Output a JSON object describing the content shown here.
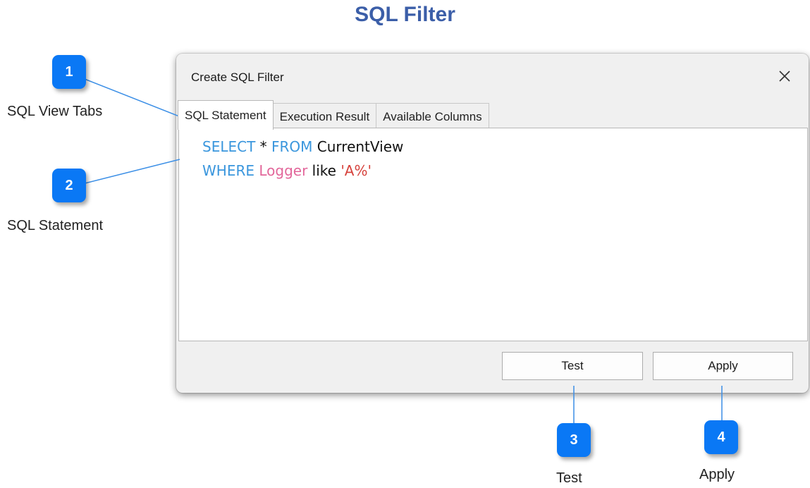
{
  "page": {
    "title": "SQL Filter"
  },
  "dialog": {
    "title": "Create SQL Filter",
    "tabs": [
      {
        "label": "SQL Statement",
        "active": true
      },
      {
        "label": "Execution Result",
        "active": false
      },
      {
        "label": "Available Columns",
        "active": false
      }
    ],
    "sql": {
      "line1": {
        "select": "SELECT",
        "star": " * ",
        "from": "FROM",
        "table": " CurrentView"
      },
      "line2": {
        "where": "WHERE",
        "column": " Logger",
        "op": " like ",
        "value": "'A%'"
      }
    },
    "buttons": {
      "test": "Test",
      "apply": "Apply"
    },
    "colors": {
      "keyword": "#3a96dd",
      "identifier": "#e2669a",
      "string": "#d6423c"
    }
  },
  "callouts": [
    {
      "number": "1",
      "label": "SQL View Tabs"
    },
    {
      "number": "2",
      "label": "SQL Statement"
    },
    {
      "number": "3",
      "label": "Test"
    },
    {
      "number": "4",
      "label": "Apply"
    }
  ],
  "colors": {
    "title": "#3b5ea8",
    "callout_badge": "#0a78f5",
    "connector_line": "#3a8ee6"
  }
}
